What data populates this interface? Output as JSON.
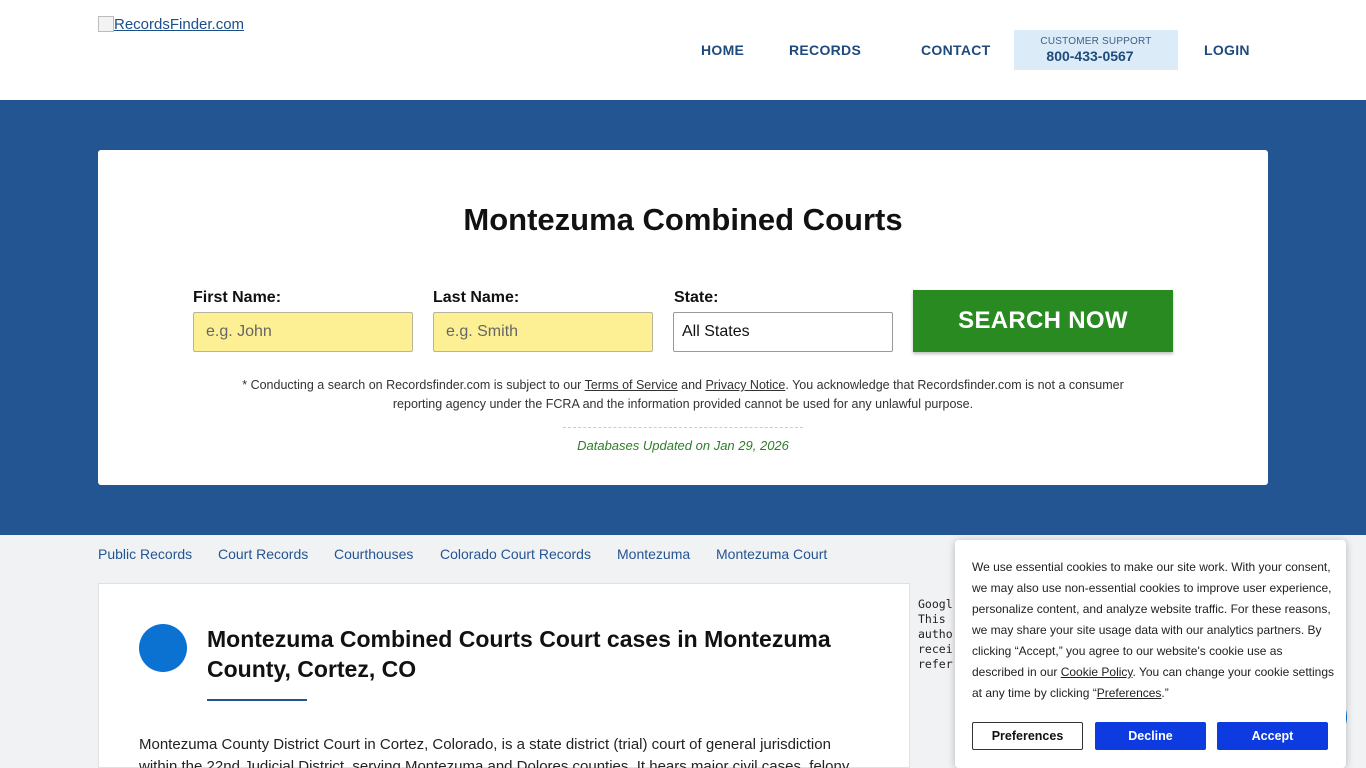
{
  "header": {
    "logo_alt": "RecordsFinder.com",
    "nav": [
      {
        "label": "HOME"
      },
      {
        "label": "RECORDS"
      },
      {
        "label": "CONTACT"
      }
    ],
    "support_label": "CUSTOMER SUPPORT",
    "support_phone": "800-433-0567",
    "login": "LOGIN"
  },
  "search": {
    "title": "Montezuma Combined Courts",
    "first_name_label": "First Name:",
    "first_name_placeholder": "e.g. John",
    "last_name_label": "Last Name:",
    "last_name_placeholder": "e.g. Smith",
    "state_label": "State:",
    "state_value": "All States",
    "button": "SEARCH NOW",
    "disclaimer_pre": "* Conducting a search on Recordsfinder.com is subject to our ",
    "terms_link": "Terms of Service",
    "disclaimer_and": " and ",
    "privacy_link": "Privacy Notice",
    "disclaimer_post": ". You acknowledge that Recordsfinder.com is not a consumer reporting agency under the FCRA and the information provided cannot be used for any unlawful purpose.",
    "db_updated": "Databases Updated on Jan 29, 2026"
  },
  "breadcrumbs": [
    "Public Records",
    "Court Records",
    "Courthouses",
    "Colorado Court Records",
    "Montezuma",
    "Montezuma Court"
  ],
  "article": {
    "title": "Montezuma Combined Courts Court cases in Montezuma County, Cortez, CO",
    "body": "Montezuma County District Court in Cortez, Colorado, is a state district (trial) court of general jurisdiction within the 22nd Judicial District, serving Montezuma and Dolores counties. It hears major civil cases, felony"
  },
  "ad": {
    "text": "Googl\nThis \nautho\nrecei\nrefer"
  },
  "cookie": {
    "text_pre": "We use essential cookies to make our site work. With your consent, we may also use non-essential cookies to improve user experience, personalize content, and analyze website traffic. For these reasons, we may share your site usage data with our analytics partners. By clicking “Accept,” you agree to our website's cookie use as described in our ",
    "policy_link": "Cookie Policy",
    "text_mid": ". You can change your cookie settings at any time by clicking “",
    "pref_link": "Preferences",
    "text_post": ".”",
    "preferences_button": "Preferences",
    "decline_button": "Decline",
    "accept_button": "Accept"
  },
  "colors": {
    "hero_blue": "#245593",
    "search_green": "#2a8a22",
    "input_yellow": "#fdf094",
    "cookie_blue": "#0e3be0"
  }
}
